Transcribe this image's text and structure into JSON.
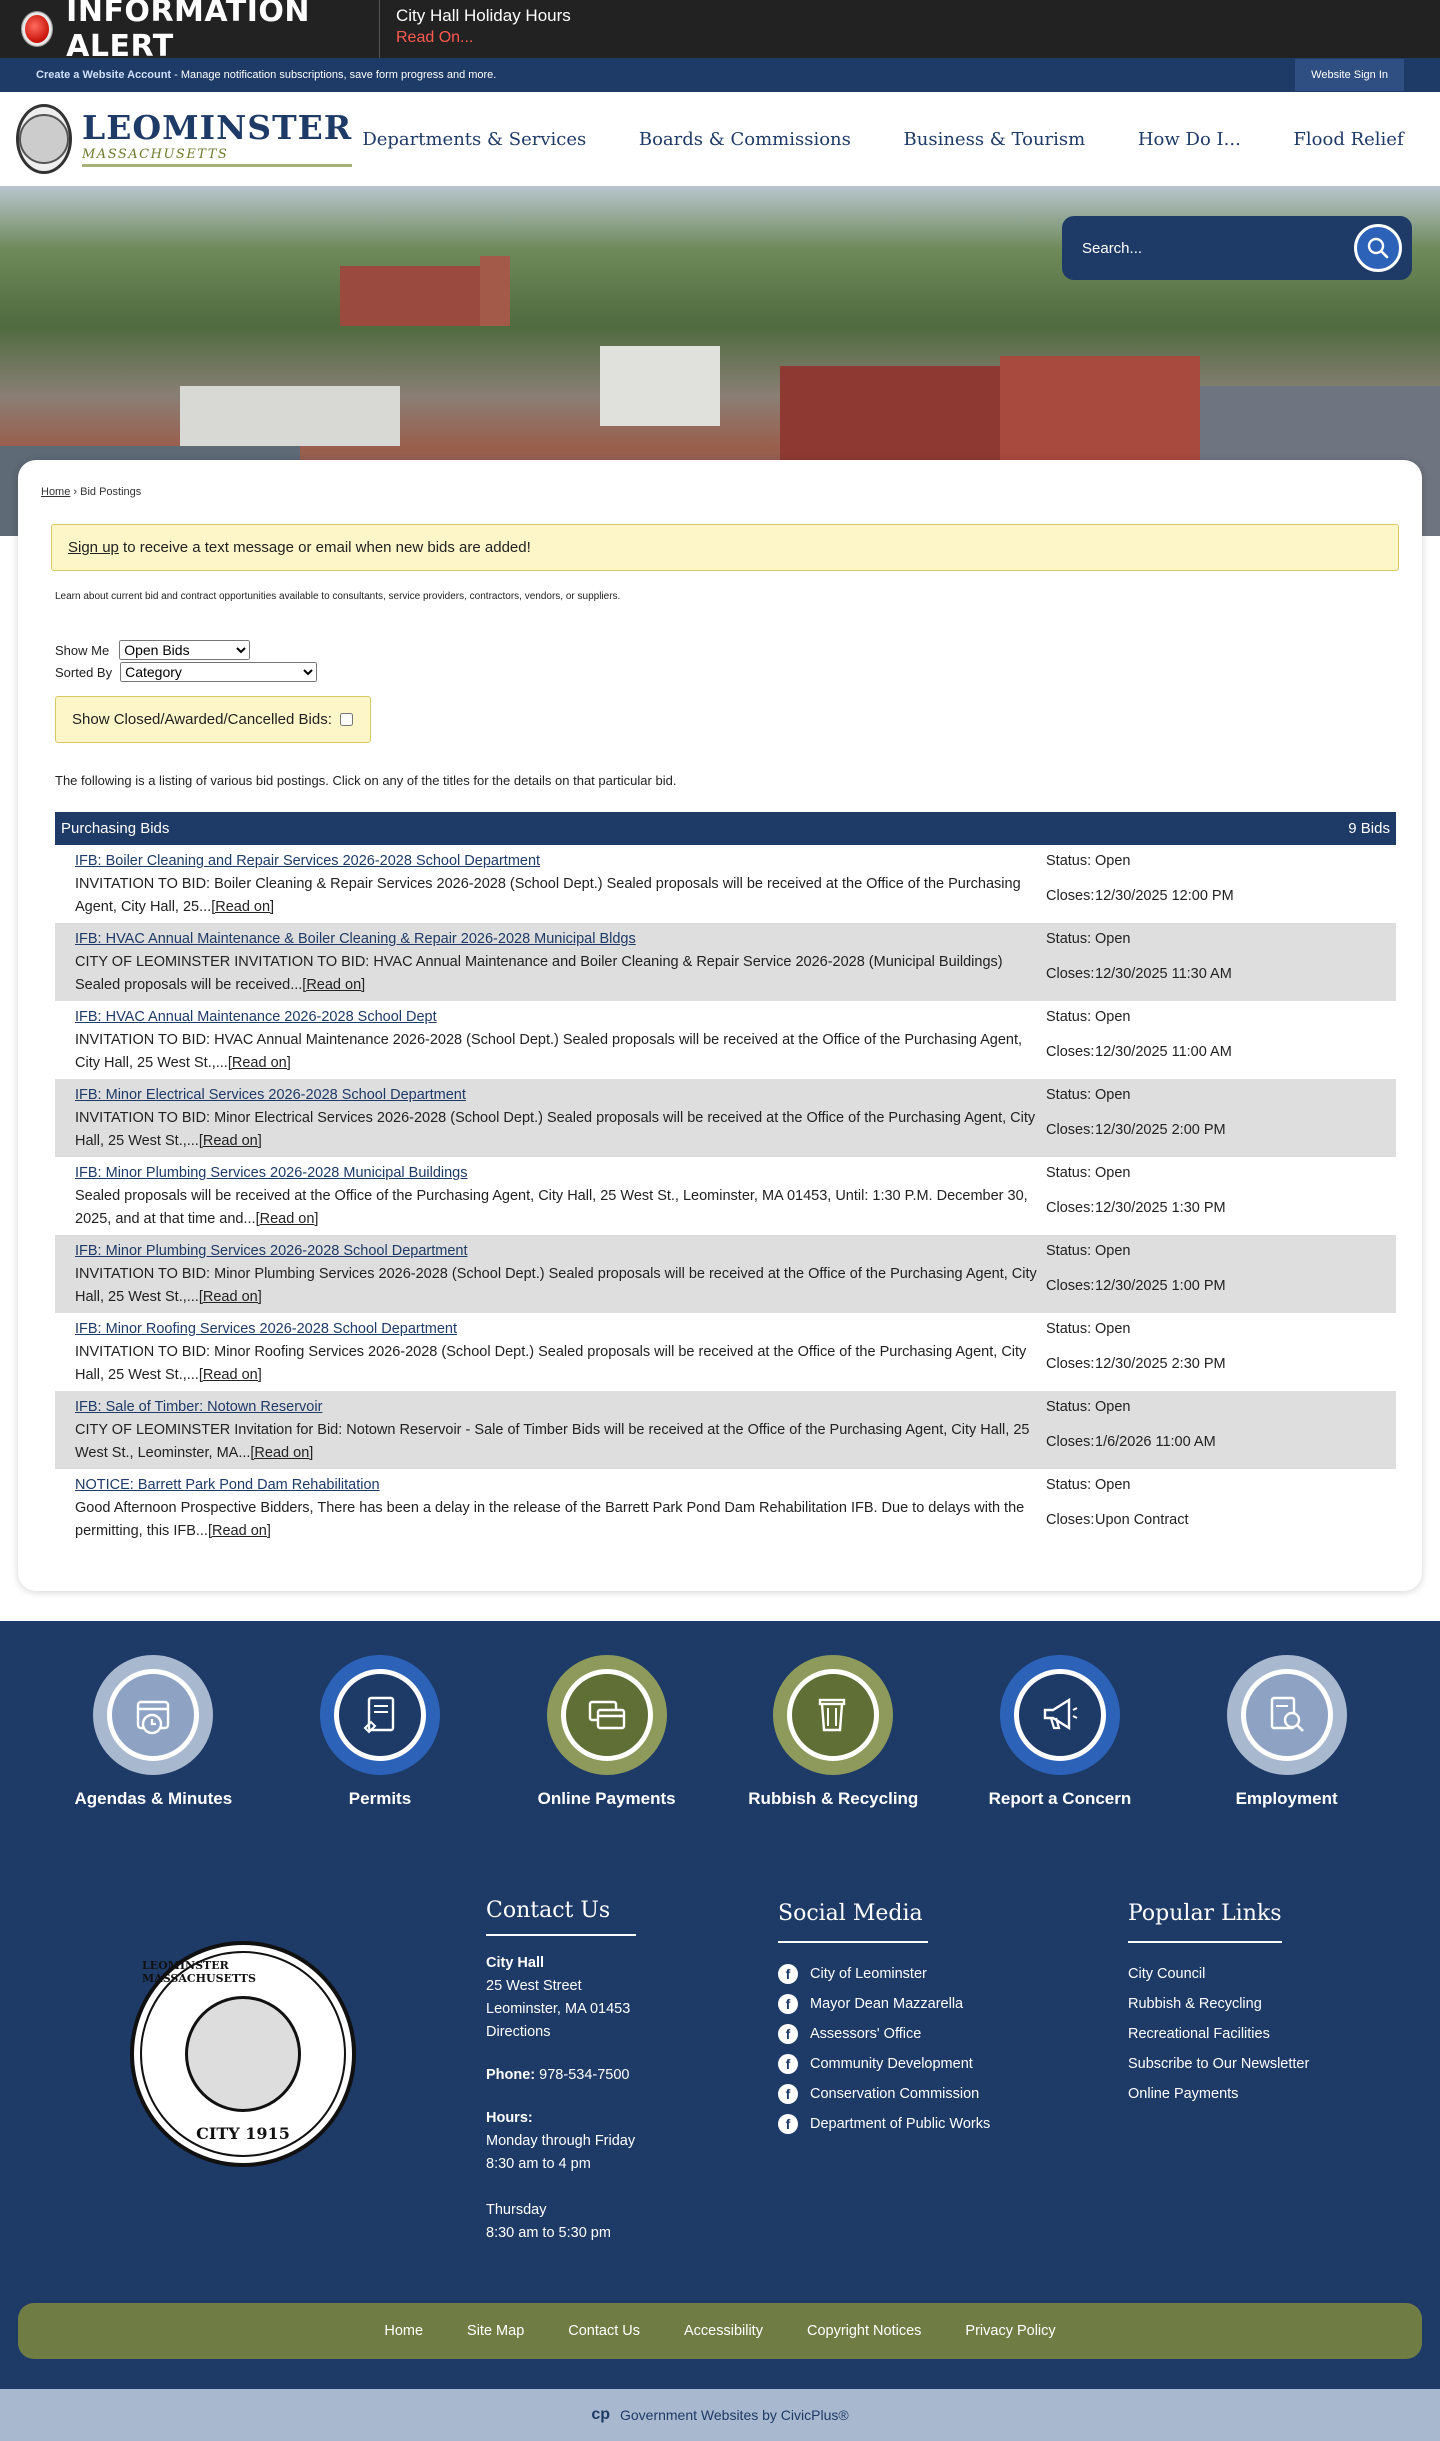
{
  "alert": {
    "title": "INFORMATION ALERT",
    "message": "City Hall Holiday Hours",
    "link": "Read On..."
  },
  "account_bar": {
    "create_link": "Create a Website Account",
    "description": " - Manage notification subscriptions, save form progress and more.",
    "sign_in": "Website Sign In"
  },
  "header": {
    "logo_name": "LEOMINSTER",
    "logo_state": "MASSACHUSETTS",
    "nav": [
      "Departments & Services",
      "Boards & Commissions",
      "Business & Tourism",
      "How Do I...",
      "Flood Relief"
    ]
  },
  "search": {
    "placeholder": "Search..."
  },
  "breadcrumb": {
    "home": "Home",
    "separator": " › ",
    "current": "Bid Postings"
  },
  "signup": {
    "link": "Sign up",
    "text": " to receive a text message or email when new bids are added!"
  },
  "intro": "Learn about current bid and contract opportunities available to consultants, service providers, contractors, vendors, or suppliers.",
  "filters": {
    "show_me_label": "Show Me",
    "show_me_value": "Open Bids",
    "sorted_by_label": "Sorted By",
    "sorted_by_value": "Category",
    "closed_label": "Show Closed/Awarded/Cancelled Bids:"
  },
  "listing_note": "The following is a listing of various bid postings. Click on any of the titles for the details on that particular bid.",
  "bids": {
    "category": "Purchasing Bids",
    "count": "9 Bids",
    "status_label": "Status:",
    "closes_label": "Closes:",
    "read_on": "[Read on]",
    "items": [
      {
        "title": "IFB: Boiler Cleaning and Repair Services 2026-2028 School Department",
        "desc": "INVITATION TO BID: Boiler Cleaning & Repair Services 2026-2028 (School Dept.) Sealed proposals will be received at the Office of the Purchasing Agent, City Hall, 25...",
        "status": "Open",
        "closes": "12/30/2025 12:00 PM"
      },
      {
        "title": "IFB: HVAC Annual Maintenance & Boiler Cleaning & Repair 2026-2028 Municipal Bldgs",
        "desc": "CITY OF LEOMINSTER INVITATION TO BID: HVAC Annual Maintenance and Boiler Cleaning & Repair Service 2026-2028 (Municipal Buildings) Sealed proposals will be received...",
        "status": "Open",
        "closes": "12/30/2025 11:30 AM"
      },
      {
        "title": "IFB: HVAC Annual Maintenance 2026-2028 School Dept",
        "desc": "INVITATION TO BID: HVAC Annual Maintenance 2026-2028 (School Dept.) Sealed proposals will be received at the Office of the Purchasing Agent, City Hall, 25 West St.,...",
        "status": "Open",
        "closes": "12/30/2025 11:00 AM"
      },
      {
        "title": "IFB: Minor Electrical Services 2026-2028 School Department",
        "desc": "INVITATION TO BID: Minor Electrical Services 2026-2028 (School Dept.) Sealed proposals will be received at the Office of the Purchasing Agent, City Hall, 25 West St.,...",
        "status": "Open",
        "closes": "12/30/2025 2:00 PM"
      },
      {
        "title": "IFB: Minor Plumbing Services 2026-2028 Municipal Buildings",
        "desc": "Sealed proposals will be received at the Office of the Purchasing Agent, City Hall, 25 West St., Leominster, MA 01453, Until: 1:30 P.M. December 30, 2025, and at that time and...",
        "status": "Open",
        "closes": "12/30/2025 1:30 PM"
      },
      {
        "title": "IFB: Minor Plumbing Services 2026-2028 School Department",
        "desc": "INVITATION TO BID: Minor Plumbing Services 2026-2028 (School Dept.) Sealed proposals will be received at the Office of the Purchasing Agent, City Hall, 25 West St.,...",
        "status": "Open",
        "closes": "12/30/2025 1:00 PM"
      },
      {
        "title": "IFB: Minor Roofing Services 2026-2028 School Department",
        "desc": "INVITATION TO BID: Minor Roofing Services 2026-2028 (School Dept.) Sealed proposals will be received at the Office of the Purchasing Agent, City Hall, 25 West St.,...",
        "status": "Open",
        "closes": "12/30/2025 2:30 PM"
      },
      {
        "title": "IFB: Sale of Timber: Notown Reservoir",
        "desc": "CITY OF LEOMINSTER Invitation for Bid: Notown Reservoir - Sale of Timber Bids will be received at the Office of the Purchasing Agent, City Hall, 25 West St., Leominster, MA...",
        "status": "Open",
        "closes": "1/6/2026 11:00 AM"
      },
      {
        "title": "NOTICE: Barrett Park Pond Dam Rehabilitation",
        "desc": "Good Afternoon Prospective Bidders, There has been a delay in the release of the Barrett Park Pond Dam Rehabilitation IFB. Due to delays with the permitting, this IFB...",
        "status": "Open",
        "closes": "Upon Contract"
      }
    ]
  },
  "quick_links": [
    {
      "label": "Agendas & Minutes",
      "icon": "calendar-clock-icon",
      "ring": "#a8b8cf",
      "fill": "#8ea3c4"
    },
    {
      "label": "Permits",
      "icon": "permit-document-icon",
      "ring": "#2c63b8",
      "fill": "#1e3a67"
    },
    {
      "label": "Online Payments",
      "icon": "credit-card-icon",
      "ring": "#8d9a5b",
      "fill": "#5f6f35"
    },
    {
      "label": "Rubbish & Recycling",
      "icon": "trash-can-icon",
      "ring": "#8d9a5b",
      "fill": "#5f6f35"
    },
    {
      "label": "Report a Concern",
      "icon": "megaphone-icon",
      "ring": "#2c63b8",
      "fill": "#1e3a67"
    },
    {
      "label": "Employment",
      "icon": "document-search-icon",
      "ring": "#a8b8cf",
      "fill": "#8ea3c4"
    }
  ],
  "seal": {
    "top": "LEOMINSTER MASSACHUSETTS",
    "bottom": "CITY 1915"
  },
  "contact": {
    "heading": "Contact Us",
    "name": "City Hall",
    "street": "25 West Street",
    "city": "Leominster, MA 01453",
    "directions": "Directions",
    "phone_label": "Phone:",
    "phone": " 978-534-7500",
    "hours_label": "Hours:",
    "hours_1_days": "Monday through Friday",
    "hours_1_time": "8:30 am to 4 pm",
    "hours_2_days": "Thursday",
    "hours_2_time": "8:30 am to 5:30 pm"
  },
  "social": {
    "heading": "Social Media",
    "items": [
      "City of Leominster",
      "Mayor Dean Mazzarella",
      "Assessors' Office",
      "Community Development",
      "Conservation Commission",
      "Department of Public Works"
    ]
  },
  "popular": {
    "heading": "Popular Links",
    "items": [
      "City Council",
      "Rubbish & Recycling",
      "Recreational Facilities",
      "Subscribe to Our Newsletter",
      "Online Payments"
    ]
  },
  "bottom_nav": [
    "Home",
    "Site Map",
    "Contact Us",
    "Accessibility",
    "Copyright Notices",
    "Privacy Policy"
  ],
  "credit": {
    "logo": "cp",
    "text": "Government Websites by CivicPlus®"
  },
  "colors": {
    "navy": "#1e3a67",
    "olive": "#6f7d45",
    "alert_red": "#ff5a4e"
  }
}
